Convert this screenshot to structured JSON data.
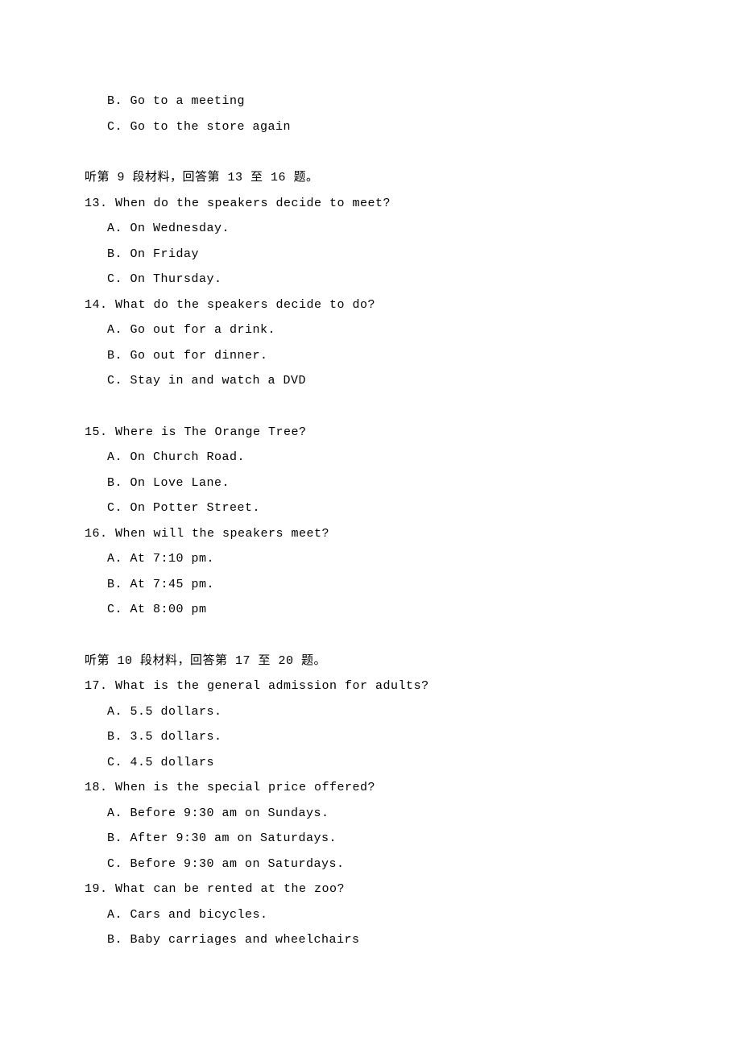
{
  "prev_options": {
    "b": "B. Go to a meeting",
    "c": "C. Go to the store again"
  },
  "section9": {
    "header": "听第 9 段材料，回答第 13 至 16 题。",
    "q13": {
      "text": "13. When do the speakers decide to meet?",
      "a": "A. On Wednesday.",
      "b": "B. On Friday",
      "c": "C. On Thursday."
    },
    "q14": {
      "text": "14. What do the speakers decide to do?",
      "a": "A. Go out for a drink.",
      "b": "B. Go out for dinner.",
      "c": "C. Stay in and watch a DVD"
    },
    "q15": {
      "text": "15. Where is The Orange Tree?",
      "a": "A. On Church Road.",
      "b": "B. On Love Lane.",
      "c": "C. On Potter Street."
    },
    "q16": {
      "text": "16. When will the speakers meet?",
      "a": "A. At 7:10 pm.",
      "b": "B. At 7:45 pm.",
      "c": "C. At 8:00 pm"
    }
  },
  "section10": {
    "header": "听第 10 段材料，回答第 17 至 20 题。",
    "q17": {
      "text": "17. What is the general admission for adults?",
      "a": "A. 5.5 dollars.",
      "b": "B. 3.5 dollars.",
      "c": "C. 4.5 dollars"
    },
    "q18": {
      "text": "18. When is the special price offered?",
      "a": "A. Before 9:30 am on Sundays.",
      "b": "B. After 9:30 am on Saturdays.",
      "c": "C. Before 9:30 am on Saturdays."
    },
    "q19": {
      "text": "19. What can be rented at the zoo?",
      "a": "A. Cars and bicycles.",
      "b": "B. Baby carriages and wheelchairs"
    }
  }
}
